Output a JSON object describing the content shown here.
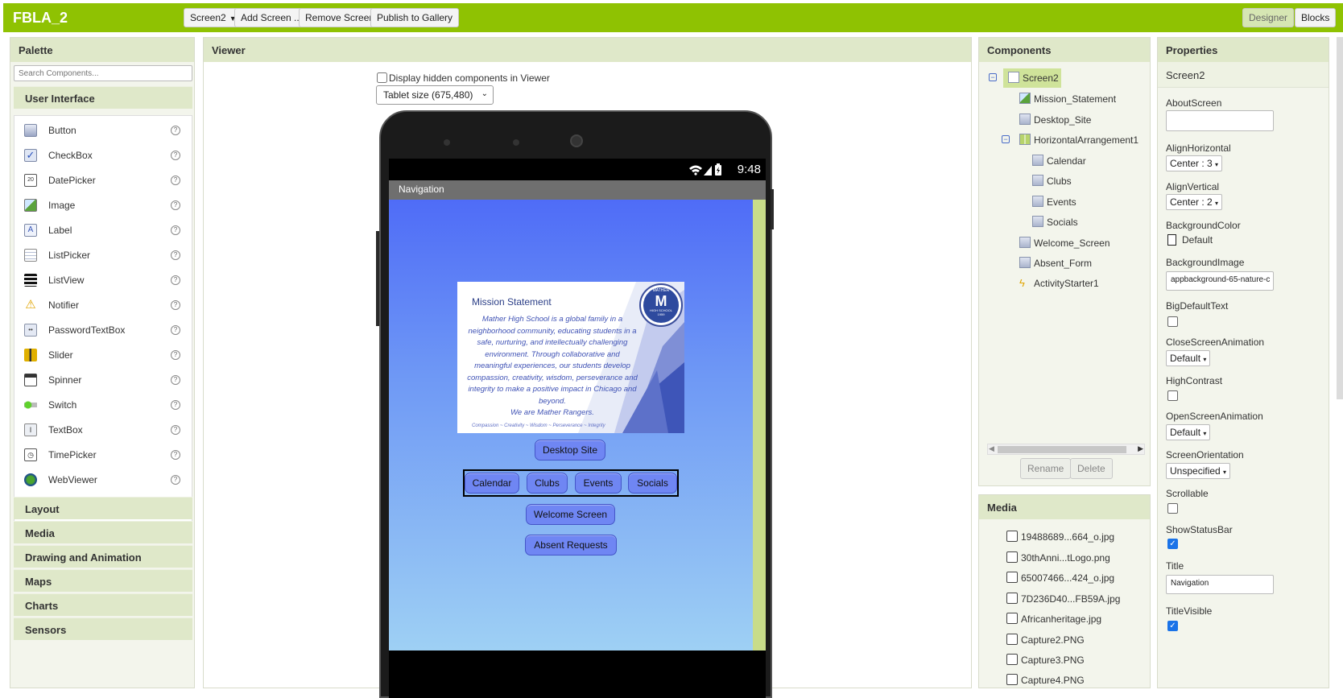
{
  "app": {
    "title": "FBLA_2"
  },
  "toolbar": {
    "screen_select": "Screen2",
    "add_screen": "Add Screen ...",
    "remove_screen": "Remove Screen",
    "publish": "Publish to Gallery",
    "designer": "Designer",
    "blocks": "Blocks"
  },
  "palette": {
    "title": "Palette",
    "search_placeholder": "Search Components...",
    "category_open": "User Interface",
    "items": [
      {
        "label": "Button",
        "icon": "button-icon"
      },
      {
        "label": "CheckBox",
        "icon": "checkbox-icon"
      },
      {
        "label": "DatePicker",
        "icon": "datepicker-icon"
      },
      {
        "label": "Image",
        "icon": "image-icon"
      },
      {
        "label": "Label",
        "icon": "label-icon"
      },
      {
        "label": "ListPicker",
        "icon": "listpicker-icon"
      },
      {
        "label": "ListView",
        "icon": "listview-icon"
      },
      {
        "label": "Notifier",
        "icon": "notifier-icon"
      },
      {
        "label": "PasswordTextBox",
        "icon": "password-icon"
      },
      {
        "label": "Slider",
        "icon": "slider-icon"
      },
      {
        "label": "Spinner",
        "icon": "spinner-icon"
      },
      {
        "label": "Switch",
        "icon": "switch-icon"
      },
      {
        "label": "TextBox",
        "icon": "textbox-icon"
      },
      {
        "label": "TimePicker",
        "icon": "timepicker-icon"
      },
      {
        "label": "WebViewer",
        "icon": "webviewer-icon"
      }
    ],
    "categories": [
      "Layout",
      "Media",
      "Drawing and Animation",
      "Maps",
      "Charts",
      "Sensors"
    ]
  },
  "viewer": {
    "title": "Viewer",
    "hidden_checkbox_label": "Display hidden components in Viewer",
    "size_select": "Tablet size (675,480)",
    "phone": {
      "time": "9:48",
      "title": "Navigation",
      "mission": {
        "title": "Mission Statement",
        "body": "Mather High School is a global family in a neighborhood community, educating students in a safe, nurturing, and intellectually challenging environment. Through collaborative and meaningful experiences, our students develop compassion, creativity, wisdom, perseverance and integrity to make a positive impact in Chicago and beyond.",
        "closing": "We are Mather Rangers.",
        "footer": "Compassion ~ Creativity ~ Wisdom ~ Perseverance ~ Integrity",
        "seal_top": "MATHER",
        "seal_letter": "M",
        "seal_bottom": "HIGH SCHOOL",
        "seal_year": "1959"
      },
      "buttons": {
        "desktop": "Desktop Site",
        "calendar": "Calendar",
        "clubs": "Clubs",
        "events": "Events",
        "socials": "Socials",
        "welcome": "Welcome Screen",
        "absent": "Absent Requests"
      }
    }
  },
  "components": {
    "title": "Components",
    "tree": {
      "screen": "Screen2",
      "mission": "Mission_Statement",
      "desktop": "Desktop_Site",
      "harr": "HorizontalArrangement1",
      "calendar": "Calendar",
      "clubs": "Clubs",
      "events": "Events",
      "socials": "Socials",
      "welcome": "Welcome_Screen",
      "absent": "Absent_Form",
      "activity": "ActivityStarter1"
    },
    "rename": "Rename",
    "delete": "Delete"
  },
  "media": {
    "title": "Media",
    "items": [
      "19488689...664_o.jpg",
      "30thAnni...tLogo.png",
      "65007466...424_o.jpg",
      "7D236D40...FB59A.jpg",
      "Africanheritage.jpg",
      "Capture2.PNG",
      "Capture3.PNG",
      "Capture4.PNG"
    ]
  },
  "properties": {
    "title": "Properties",
    "component": "Screen2",
    "about_screen": {
      "label": "AboutScreen",
      "value": ""
    },
    "align_horizontal": {
      "label": "AlignHorizontal",
      "value": "Center : 3"
    },
    "align_vertical": {
      "label": "AlignVertical",
      "value": "Center : 2"
    },
    "background_color": {
      "label": "BackgroundColor",
      "value": "Default"
    },
    "background_image": {
      "label": "BackgroundImage",
      "value": "appbackground-65-nature-c"
    },
    "big_default_text": {
      "label": "BigDefaultText"
    },
    "close_anim": {
      "label": "CloseScreenAnimation",
      "value": "Default"
    },
    "high_contrast": {
      "label": "HighContrast"
    },
    "open_anim": {
      "label": "OpenScreenAnimation",
      "value": "Default"
    },
    "orientation": {
      "label": "ScreenOrientation",
      "value": "Unspecified"
    },
    "scrollable": {
      "label": "Scrollable"
    },
    "show_status_bar": {
      "label": "ShowStatusBar"
    },
    "title_prop": {
      "label": "Title",
      "value": "Navigation"
    },
    "title_visible": {
      "label": "TitleVisible"
    }
  },
  "colors": {
    "brand": "#8fc202",
    "panel_header": "#dfe8c9",
    "app_button": "#6f86f3"
  }
}
